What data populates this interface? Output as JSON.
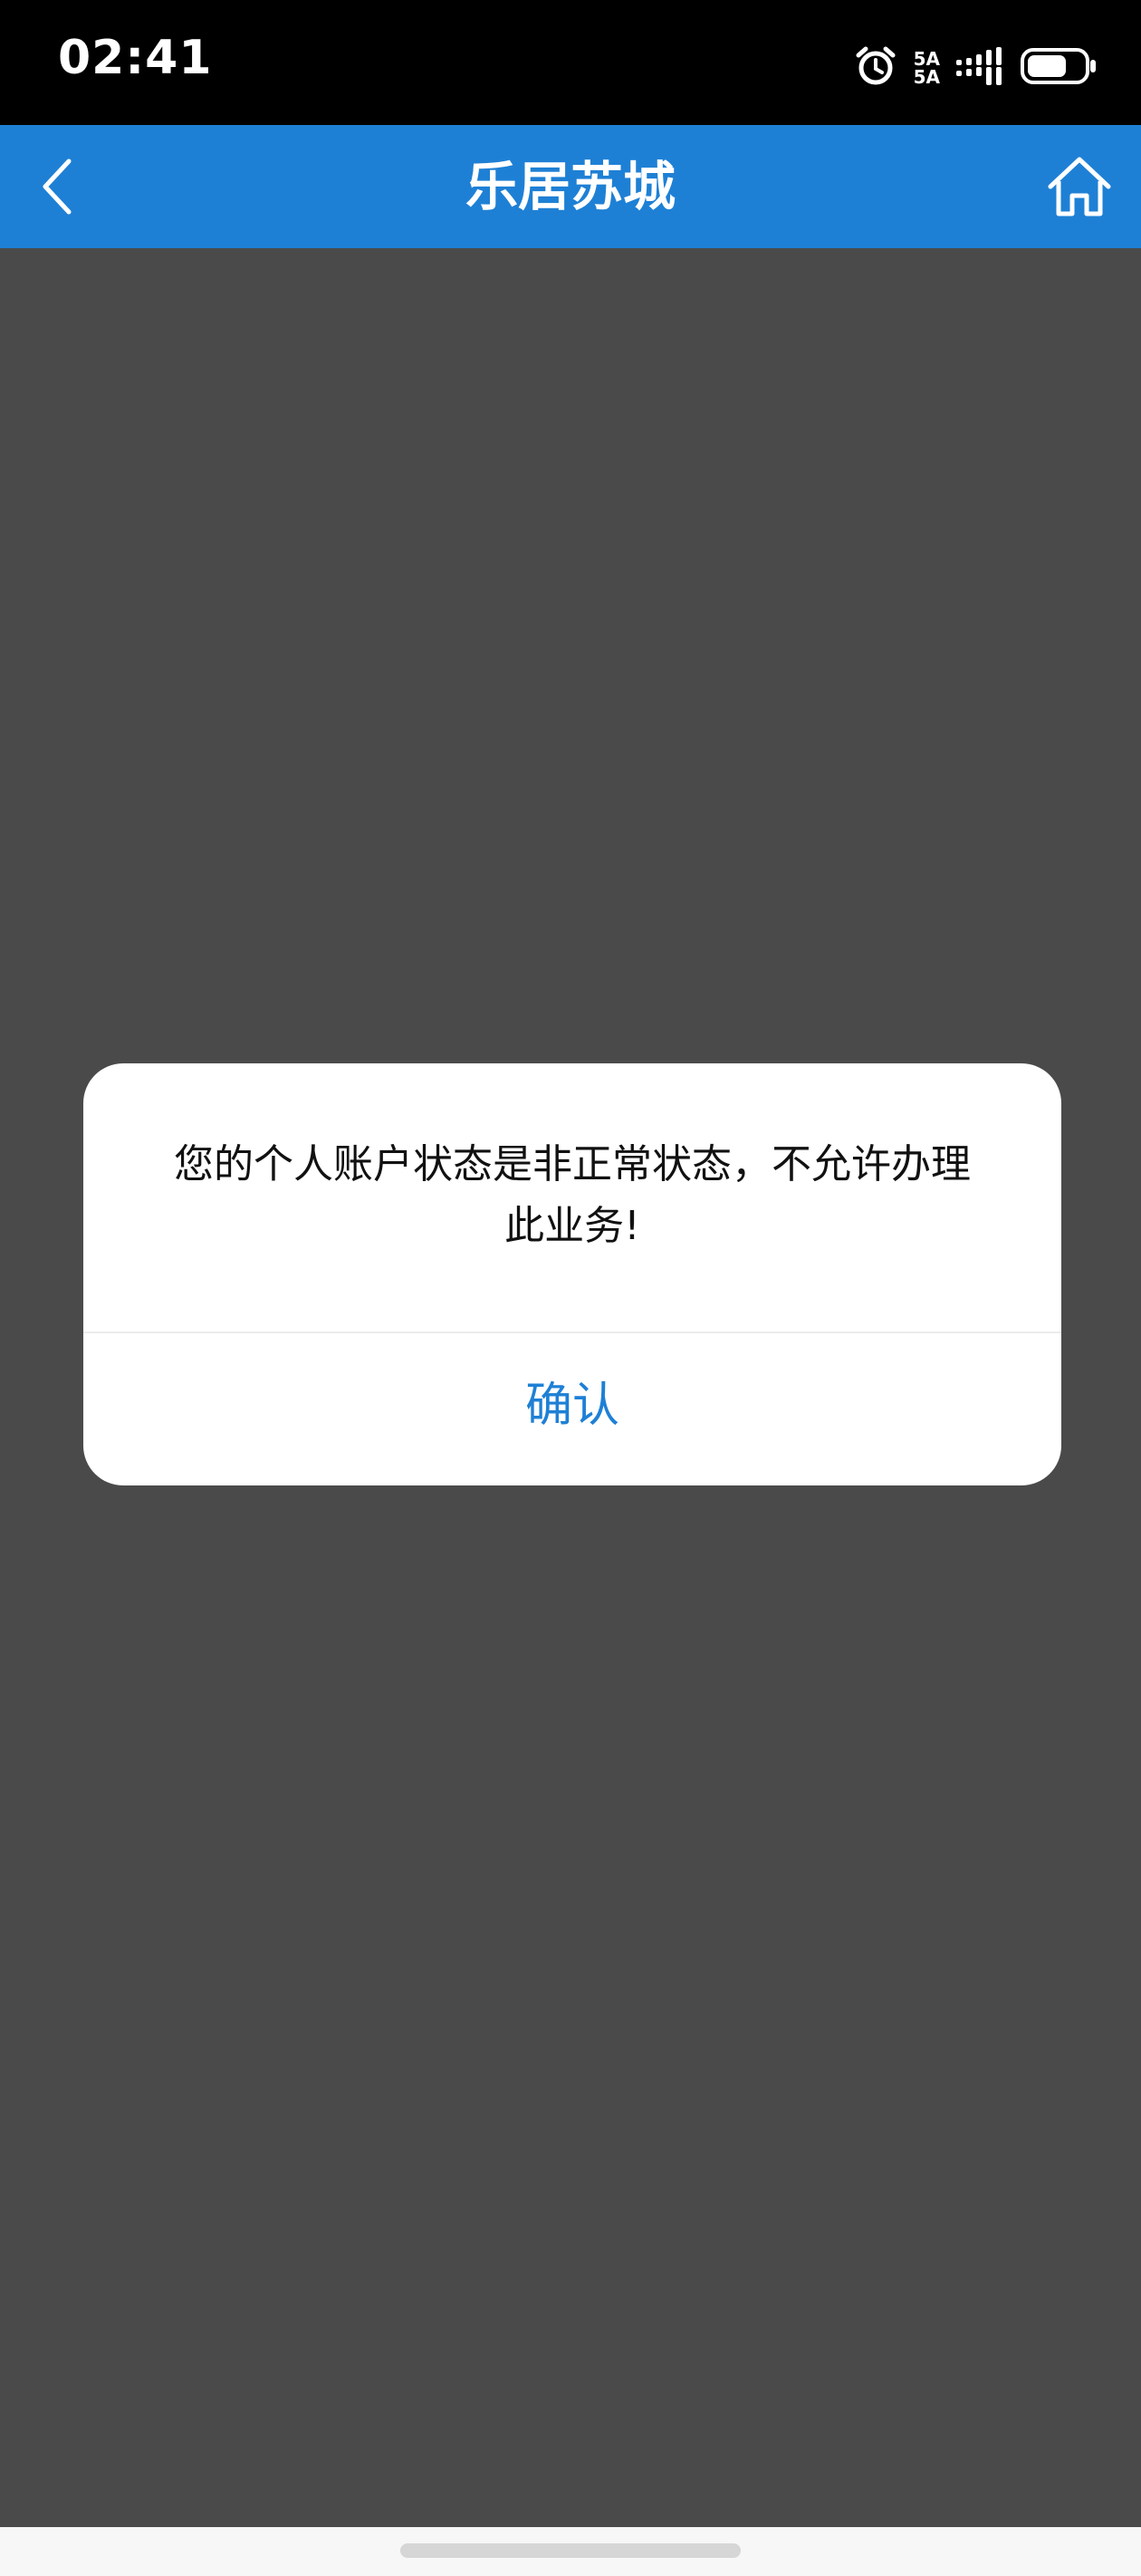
{
  "status_bar": {
    "time": "02:41",
    "network_label_1": "5A",
    "network_label_2": "5A",
    "battery_level": 0.7,
    "icons": [
      "alarm-icon",
      "signal-icon",
      "battery-icon"
    ]
  },
  "header": {
    "title": "乐居苏城",
    "back_icon": "chevron-left-icon",
    "home_icon": "home-icon",
    "background_color": "#1e80d5"
  },
  "dialog": {
    "message": "您的个人账户状态是非正常状态，不允许办理此业务!",
    "confirm_label": "确认",
    "accent_color": "#1e80d5"
  },
  "overlay_color": "#4a4a4a"
}
